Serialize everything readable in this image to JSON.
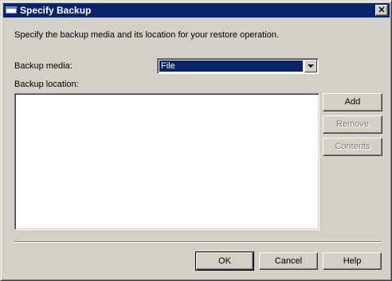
{
  "window": {
    "title": "Specify Backup"
  },
  "dialog": {
    "description": "Specify the backup media and its location for your restore operation.",
    "backup_media_label": "Backup media:",
    "backup_media_value": "File",
    "backup_location_label": "Backup location:",
    "backup_location_items": []
  },
  "side_buttons": {
    "add": "Add",
    "remove": "Remove",
    "contents": "Contents"
  },
  "footer_buttons": {
    "ok": "OK",
    "cancel": "Cancel",
    "help": "Help"
  },
  "colors": {
    "titlebar": "#0a246a",
    "face": "#d4d0c8",
    "selection": "#0a246a"
  },
  "icons": {
    "title": "window-icon",
    "close": "close-icon",
    "dropdown": "chevron-down-icon"
  }
}
